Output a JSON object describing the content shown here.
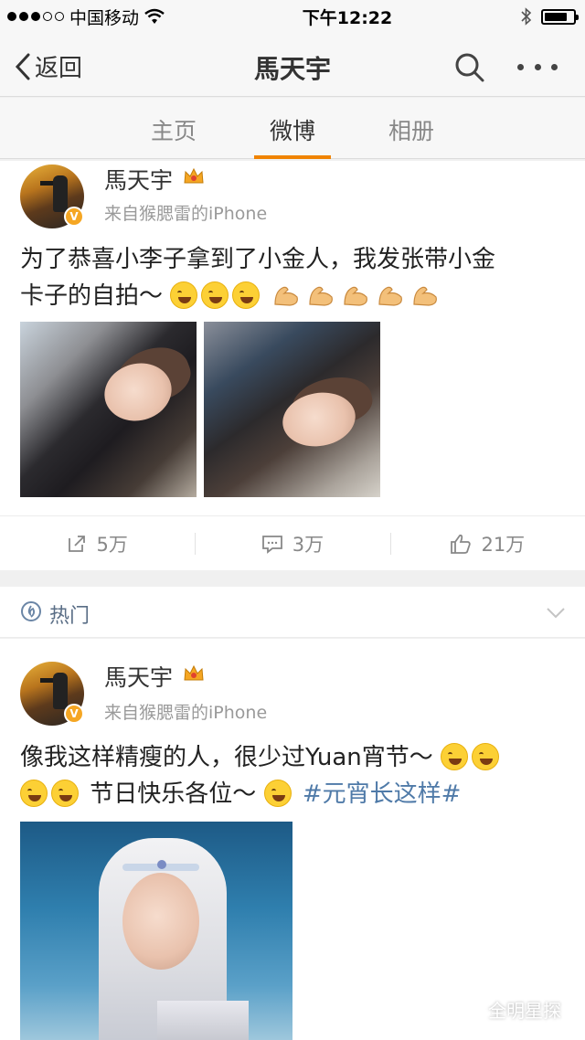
{
  "status_bar": {
    "carrier": "中国移动",
    "time": "下午12:22",
    "battery_level": 0.8
  },
  "nav": {
    "back_label": "返回",
    "title": "馬天宇"
  },
  "tabs": [
    {
      "label": "主页",
      "active": false
    },
    {
      "label": "微博",
      "active": true
    },
    {
      "label": "相册",
      "active": false
    }
  ],
  "posts": [
    {
      "user_name": "馬天宇",
      "source": "来自猴腮雷的iPhone",
      "text_line1": "为了恭喜小李子拿到了小金人，我发张带小金",
      "text_line2": "卡子的自拍～",
      "actions": {
        "repost": "5万",
        "comment": "3万",
        "like": "21万"
      }
    },
    {
      "user_name": "馬天宇",
      "source": "来自猴腮雷的iPhone",
      "text_line1": "像我这样精瘦的人，很少过Yuan宵节～",
      "text_line2": "节日快乐各位～",
      "hashtag": "#元宵长这样#"
    }
  ],
  "hot_section": {
    "label": "热门"
  },
  "watermark": {
    "text": "全明星探"
  },
  "colors": {
    "accent": "#f08300",
    "link": "#4f7aa8",
    "muted": "#9a9a9a"
  },
  "icons": [
    "wifi-icon",
    "bluetooth-icon",
    "battery-icon",
    "back-chevron-icon",
    "search-icon",
    "more-icon",
    "verified-badge-icon",
    "crown-icon",
    "repost-icon",
    "comment-icon",
    "like-icon",
    "hot-icon",
    "chevron-down-icon",
    "wechat-icon"
  ]
}
